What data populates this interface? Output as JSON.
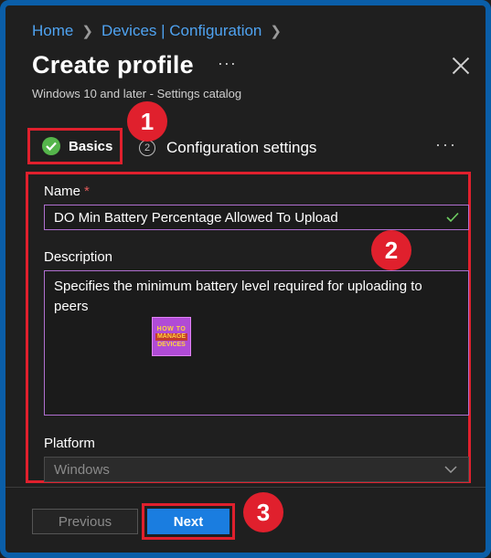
{
  "breadcrumb": {
    "items": [
      "Home",
      "Devices | Configuration"
    ]
  },
  "header": {
    "title": "Create profile",
    "more_label": "···",
    "subtitle": "Windows 10 and later - Settings catalog"
  },
  "tabs": [
    {
      "label": "Basics",
      "state": "complete"
    },
    {
      "number": "2",
      "label": "Configuration settings"
    }
  ],
  "tabs_more": "···",
  "form": {
    "name_label": "Name",
    "name_required": "*",
    "name_value": "DO Min Battery Percentage Allowed To Upload",
    "description_label": "Description",
    "description_value": "Specifies the minimum battery level required for uploading to peers",
    "platform_label": "Platform",
    "platform_value": "Windows"
  },
  "watermark": {
    "line1": "HOW TO",
    "line2": "MANAGE",
    "line3": "DEVICES"
  },
  "footer": {
    "previous_label": "Previous",
    "next_label": "Next"
  },
  "annotations": [
    "1",
    "2",
    "3"
  ],
  "colors": {
    "link": "#4fa3f1",
    "accent_button": "#1a7de0",
    "highlight": "#e0202d",
    "success": "#55b54b",
    "frame": "#0a5ea8"
  }
}
